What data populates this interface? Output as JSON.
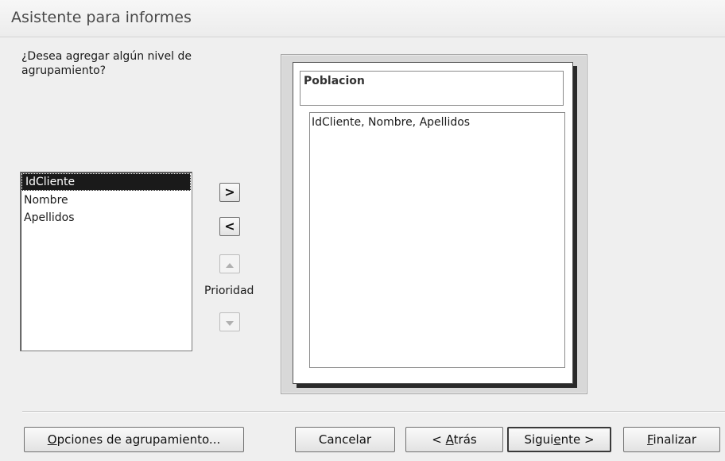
{
  "window": {
    "title": "Asistente para informes"
  },
  "prompt": {
    "question": "¿Desea agregar algún nivel de agrupamiento?"
  },
  "fields": {
    "items": [
      "IdCliente",
      "Nombre",
      "Apellidos"
    ],
    "selected": "IdCliente"
  },
  "arrows": {
    "add": ">",
    "remove": "<"
  },
  "priority": {
    "label": "Prioridad"
  },
  "preview": {
    "group_header": "Poblacion",
    "detail_fields": "IdCliente, Nombre, Apellidos"
  },
  "buttons": {
    "grouping_options": {
      "mnemonic": "O",
      "rest": "pciones de agrupamiento..."
    },
    "cancel": "Cancelar",
    "back": {
      "prefix": "< ",
      "mnemonic": "A",
      "rest": "trás"
    },
    "next": {
      "prefix": "Sigui",
      "mnemonic": "e",
      "rest": "nte >"
    },
    "finish": {
      "mnemonic": "F",
      "rest": "inalizar"
    }
  }
}
